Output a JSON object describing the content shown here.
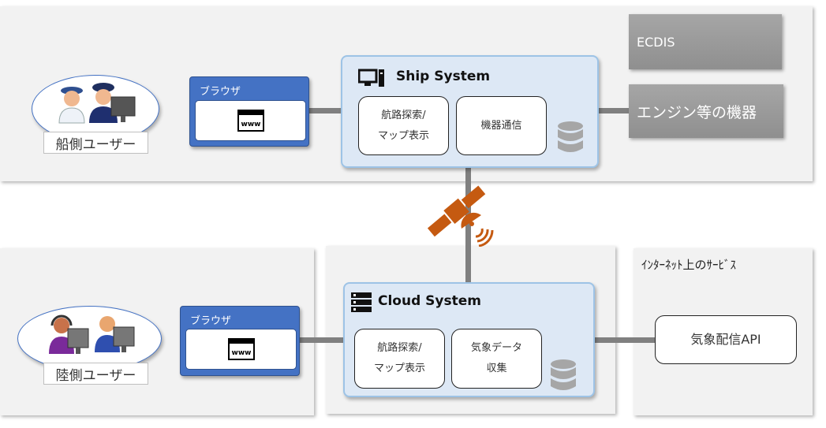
{
  "ship_area": {
    "users_label": "船側ユーザー",
    "browser_label": "ブラウザ",
    "www_label": "www",
    "system_title": "Ship System",
    "modules": [
      {
        "lines": [
          "航路探索/",
          "マップ表示"
        ]
      },
      {
        "lines": [
          "機器通信"
        ]
      }
    ],
    "ecdis_label": "ECDIS",
    "equipment_label": "エンジン等の機器"
  },
  "land_area": {
    "users_label": "陸側ユーザー",
    "browser_label": "ブラウザ",
    "www_label": "www",
    "system_title": "Cloud System",
    "modules": [
      {
        "lines": [
          "航路探索/",
          "マップ表示"
        ]
      },
      {
        "lines": [
          "気象データ",
          "収集"
        ]
      }
    ]
  },
  "internet_area": {
    "title": "ｲﾝﾀｰﾈｯﾄ上のｻｰﾋﾞｽ",
    "api_label": "気象配信API"
  },
  "colors": {
    "browser": "#4472c4",
    "system_bg": "#dde8f5",
    "system_border": "#9dc3e6",
    "satellite": "#c55a11",
    "connector": "#808080"
  }
}
